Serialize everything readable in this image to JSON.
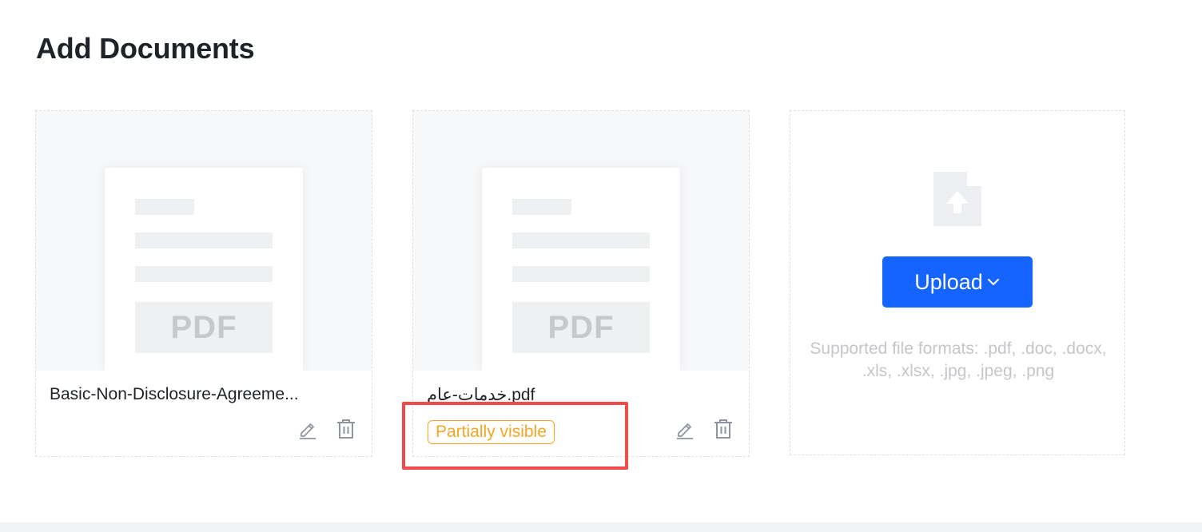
{
  "page": {
    "title": "Add Documents"
  },
  "documents": [
    {
      "preview_label": "PDF",
      "file_name": "Basic-Non-Disclosure-Agreement.pdf",
      "file_name_display": "Basic-Non-Disclosure-Agreeme...",
      "edit_icon": "pencil-icon",
      "delete_icon": "trash-icon"
    },
    {
      "preview_label": "PDF",
      "file_name_display": "خدمات-عام.pdf",
      "status_badge": "Partially visible",
      "edit_icon": "pencil-icon",
      "delete_icon": "trash-icon"
    }
  ],
  "upload": {
    "icon": "file-upload-icon",
    "button_label": "Upload",
    "dropdown_icon": "chevron-down-icon",
    "supported_formats": "Supported file formats: .pdf, .doc, .docx, .xls, .xlsx, .jpg, .jpeg, .png"
  },
  "colors": {
    "primary": "#1664ff",
    "warning": "#f5a623",
    "highlight": "#ef4b4b",
    "placeholder_text": "#c4c6ca"
  }
}
